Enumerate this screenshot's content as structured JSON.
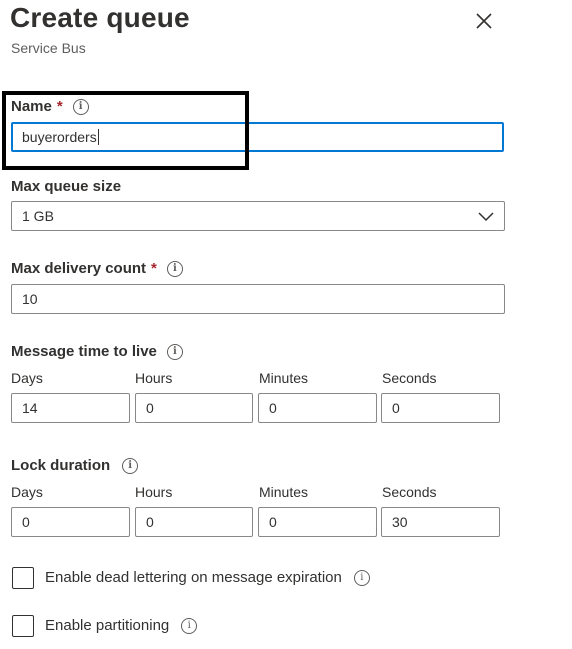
{
  "header": {
    "title": "Create queue",
    "subtitle": "Service Bus"
  },
  "name": {
    "label": "Name",
    "required_mark": "*",
    "value": "buyerorders"
  },
  "max_queue_size": {
    "label": "Max queue size",
    "selected": "1 GB"
  },
  "max_delivery_count": {
    "label": "Max delivery count",
    "required_mark": "*",
    "value": "10"
  },
  "message_ttl": {
    "label": "Message time to live",
    "days_label": "Days",
    "hours_label": "Hours",
    "minutes_label": "Minutes",
    "seconds_label": "Seconds",
    "days": "14",
    "hours": "0",
    "minutes": "0",
    "seconds": "0"
  },
  "lock_duration": {
    "label": "Lock duration",
    "days_label": "Days",
    "hours_label": "Hours",
    "minutes_label": "Minutes",
    "seconds_label": "Seconds",
    "days": "0",
    "hours": "0",
    "minutes": "0",
    "seconds": "30"
  },
  "options": {
    "dead_lettering_label": "Enable dead lettering on message expiration",
    "dead_lettering_checked": false,
    "partitioning_label": "Enable partitioning",
    "partitioning_checked": false
  },
  "icons": {
    "info": "info-icon",
    "close": "close-icon",
    "dropdown": "chevron-down-icon"
  },
  "colors": {
    "focus_border": "#0078d4",
    "required": "#a4262c",
    "text": "#323130",
    "secondary_text": "#605e5c"
  }
}
